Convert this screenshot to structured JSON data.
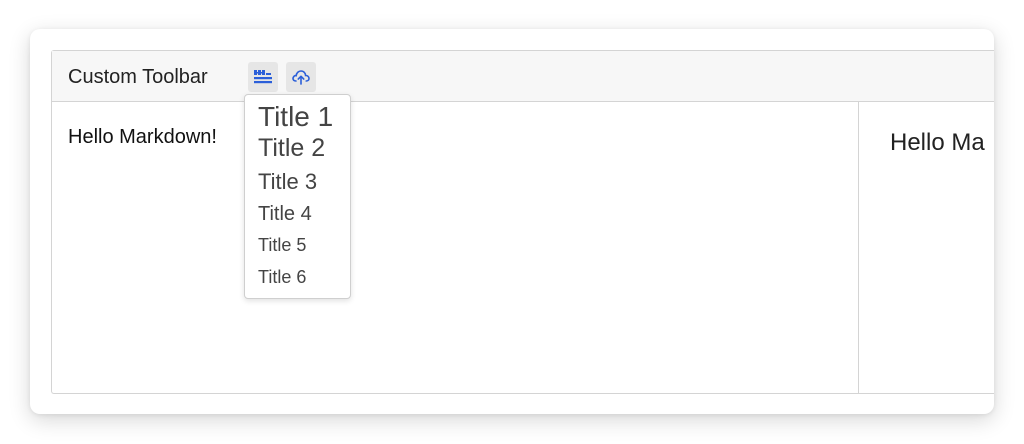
{
  "toolbar": {
    "title": "Custom Toolbar",
    "buttons": [
      {
        "icon": "heading-icon",
        "color": "#2b5fd9"
      },
      {
        "icon": "cloud-upload-icon",
        "color": "#2b5fd9"
      }
    ]
  },
  "dropdown": {
    "items": [
      {
        "label": "Title 1"
      },
      {
        "label": "Title 2"
      },
      {
        "label": "Title 3"
      },
      {
        "label": "Title 4"
      },
      {
        "label": "Title 5"
      },
      {
        "label": "Title 6"
      }
    ]
  },
  "editor": {
    "text": "Hello Markdown!"
  },
  "preview": {
    "text": "Hello Ma"
  },
  "colors": {
    "accent": "#2b5fd9",
    "border": "#d4d4d4",
    "toolbar_bg": "#f7f7f7"
  }
}
